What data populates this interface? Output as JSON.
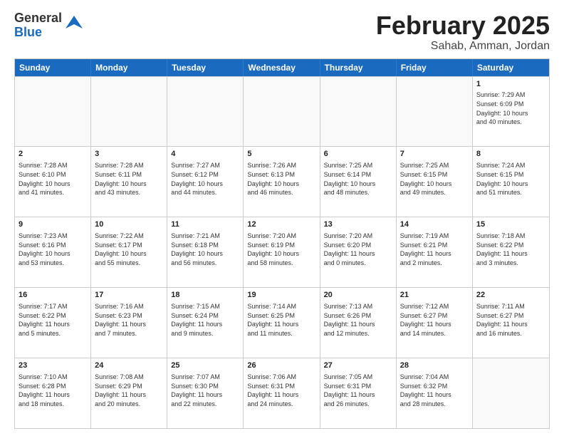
{
  "header": {
    "logo_general": "General",
    "logo_blue": "Blue",
    "month_title": "February 2025",
    "location": "Sahab, Amman, Jordan"
  },
  "weekdays": [
    "Sunday",
    "Monday",
    "Tuesday",
    "Wednesday",
    "Thursday",
    "Friday",
    "Saturday"
  ],
  "rows": [
    [
      {
        "day": "",
        "info": ""
      },
      {
        "day": "",
        "info": ""
      },
      {
        "day": "",
        "info": ""
      },
      {
        "day": "",
        "info": ""
      },
      {
        "day": "",
        "info": ""
      },
      {
        "day": "",
        "info": ""
      },
      {
        "day": "1",
        "info": "Sunrise: 7:29 AM\nSunset: 6:09 PM\nDaylight: 10 hours\nand 40 minutes."
      }
    ],
    [
      {
        "day": "2",
        "info": "Sunrise: 7:28 AM\nSunset: 6:10 PM\nDaylight: 10 hours\nand 41 minutes."
      },
      {
        "day": "3",
        "info": "Sunrise: 7:28 AM\nSunset: 6:11 PM\nDaylight: 10 hours\nand 43 minutes."
      },
      {
        "day": "4",
        "info": "Sunrise: 7:27 AM\nSunset: 6:12 PM\nDaylight: 10 hours\nand 44 minutes."
      },
      {
        "day": "5",
        "info": "Sunrise: 7:26 AM\nSunset: 6:13 PM\nDaylight: 10 hours\nand 46 minutes."
      },
      {
        "day": "6",
        "info": "Sunrise: 7:25 AM\nSunset: 6:14 PM\nDaylight: 10 hours\nand 48 minutes."
      },
      {
        "day": "7",
        "info": "Sunrise: 7:25 AM\nSunset: 6:15 PM\nDaylight: 10 hours\nand 49 minutes."
      },
      {
        "day": "8",
        "info": "Sunrise: 7:24 AM\nSunset: 6:15 PM\nDaylight: 10 hours\nand 51 minutes."
      }
    ],
    [
      {
        "day": "9",
        "info": "Sunrise: 7:23 AM\nSunset: 6:16 PM\nDaylight: 10 hours\nand 53 minutes."
      },
      {
        "day": "10",
        "info": "Sunrise: 7:22 AM\nSunset: 6:17 PM\nDaylight: 10 hours\nand 55 minutes."
      },
      {
        "day": "11",
        "info": "Sunrise: 7:21 AM\nSunset: 6:18 PM\nDaylight: 10 hours\nand 56 minutes."
      },
      {
        "day": "12",
        "info": "Sunrise: 7:20 AM\nSunset: 6:19 PM\nDaylight: 10 hours\nand 58 minutes."
      },
      {
        "day": "13",
        "info": "Sunrise: 7:20 AM\nSunset: 6:20 PM\nDaylight: 11 hours\nand 0 minutes."
      },
      {
        "day": "14",
        "info": "Sunrise: 7:19 AM\nSunset: 6:21 PM\nDaylight: 11 hours\nand 2 minutes."
      },
      {
        "day": "15",
        "info": "Sunrise: 7:18 AM\nSunset: 6:22 PM\nDaylight: 11 hours\nand 3 minutes."
      }
    ],
    [
      {
        "day": "16",
        "info": "Sunrise: 7:17 AM\nSunset: 6:22 PM\nDaylight: 11 hours\nand 5 minutes."
      },
      {
        "day": "17",
        "info": "Sunrise: 7:16 AM\nSunset: 6:23 PM\nDaylight: 11 hours\nand 7 minutes."
      },
      {
        "day": "18",
        "info": "Sunrise: 7:15 AM\nSunset: 6:24 PM\nDaylight: 11 hours\nand 9 minutes."
      },
      {
        "day": "19",
        "info": "Sunrise: 7:14 AM\nSunset: 6:25 PM\nDaylight: 11 hours\nand 11 minutes."
      },
      {
        "day": "20",
        "info": "Sunrise: 7:13 AM\nSunset: 6:26 PM\nDaylight: 11 hours\nand 12 minutes."
      },
      {
        "day": "21",
        "info": "Sunrise: 7:12 AM\nSunset: 6:27 PM\nDaylight: 11 hours\nand 14 minutes."
      },
      {
        "day": "22",
        "info": "Sunrise: 7:11 AM\nSunset: 6:27 PM\nDaylight: 11 hours\nand 16 minutes."
      }
    ],
    [
      {
        "day": "23",
        "info": "Sunrise: 7:10 AM\nSunset: 6:28 PM\nDaylight: 11 hours\nand 18 minutes."
      },
      {
        "day": "24",
        "info": "Sunrise: 7:08 AM\nSunset: 6:29 PM\nDaylight: 11 hours\nand 20 minutes."
      },
      {
        "day": "25",
        "info": "Sunrise: 7:07 AM\nSunset: 6:30 PM\nDaylight: 11 hours\nand 22 minutes."
      },
      {
        "day": "26",
        "info": "Sunrise: 7:06 AM\nSunset: 6:31 PM\nDaylight: 11 hours\nand 24 minutes."
      },
      {
        "day": "27",
        "info": "Sunrise: 7:05 AM\nSunset: 6:31 PM\nDaylight: 11 hours\nand 26 minutes."
      },
      {
        "day": "28",
        "info": "Sunrise: 7:04 AM\nSunset: 6:32 PM\nDaylight: 11 hours\nand 28 minutes."
      },
      {
        "day": "",
        "info": ""
      }
    ]
  ]
}
